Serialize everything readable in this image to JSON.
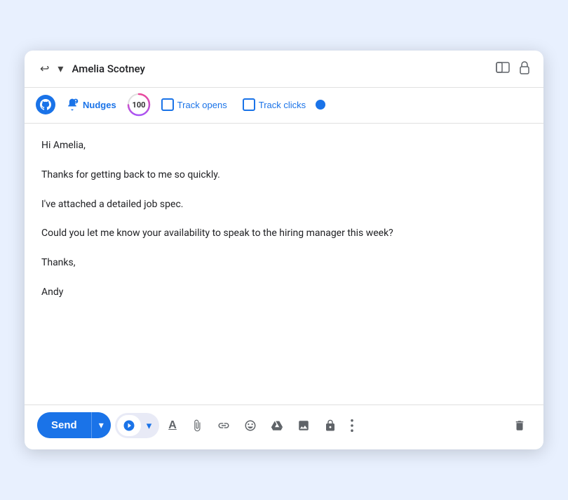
{
  "header": {
    "recipient_name": "Amelia Scotney",
    "back_icon": "↩",
    "dropdown_icon": "▾",
    "window_icon": "▣",
    "lock_icon": "🔒"
  },
  "toolbar": {
    "nudges_label": "Nudges",
    "score_value": "100",
    "track_opens_label": "Track opens",
    "track_clicks_label": "Track clicks"
  },
  "body": {
    "greeting": "Hi Amelia,",
    "line1": "Thanks for getting back to me so quickly.",
    "line2": "I've attached a detailed job spec.",
    "line3": "Could you let me know your availability to speak to the hiring manager this week?",
    "sign_off": "Thanks,",
    "signature": "Andy"
  },
  "footer": {
    "send_label": "Send",
    "send_dropdown_icon": "▾"
  }
}
